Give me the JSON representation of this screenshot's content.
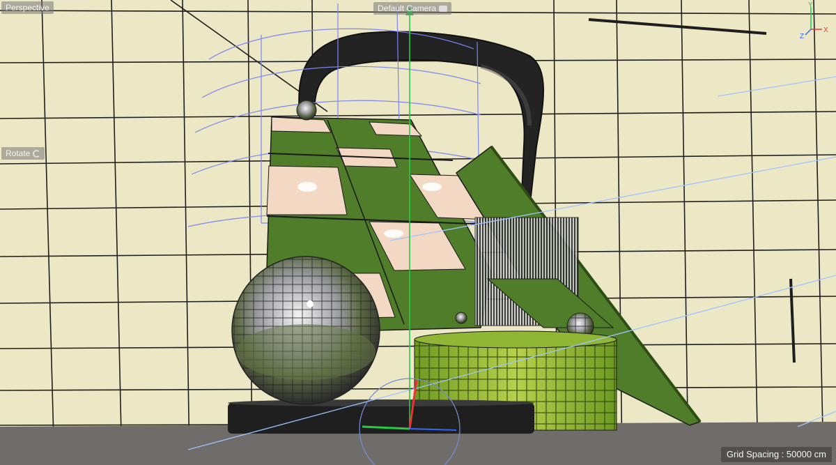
{
  "viewport": {
    "view_label": "Perspective",
    "camera_label": "Default Camera",
    "rotate_label": "Rotate",
    "grid_spacing_label": "Grid Spacing : 50000 cm"
  },
  "axis_icon": {
    "x": "X",
    "y": "Y",
    "z": "Z"
  },
  "icons": {
    "rotate": "rotate-icon",
    "camera": "camera-icon",
    "axis": "axis-gizmo-icon"
  },
  "colors": {
    "background": "#ece7c4",
    "grid_line": "#1e1e1e",
    "floor": "#6f6c69",
    "green": "#4f7d2a",
    "peach": "#f3d9c3",
    "handle": "#232323",
    "cage": "#7c86f5",
    "light_line": "#9fc4ff",
    "axis_x": "#ee3333",
    "axis_y": "#22cc44",
    "axis_z": "#3366ff"
  }
}
